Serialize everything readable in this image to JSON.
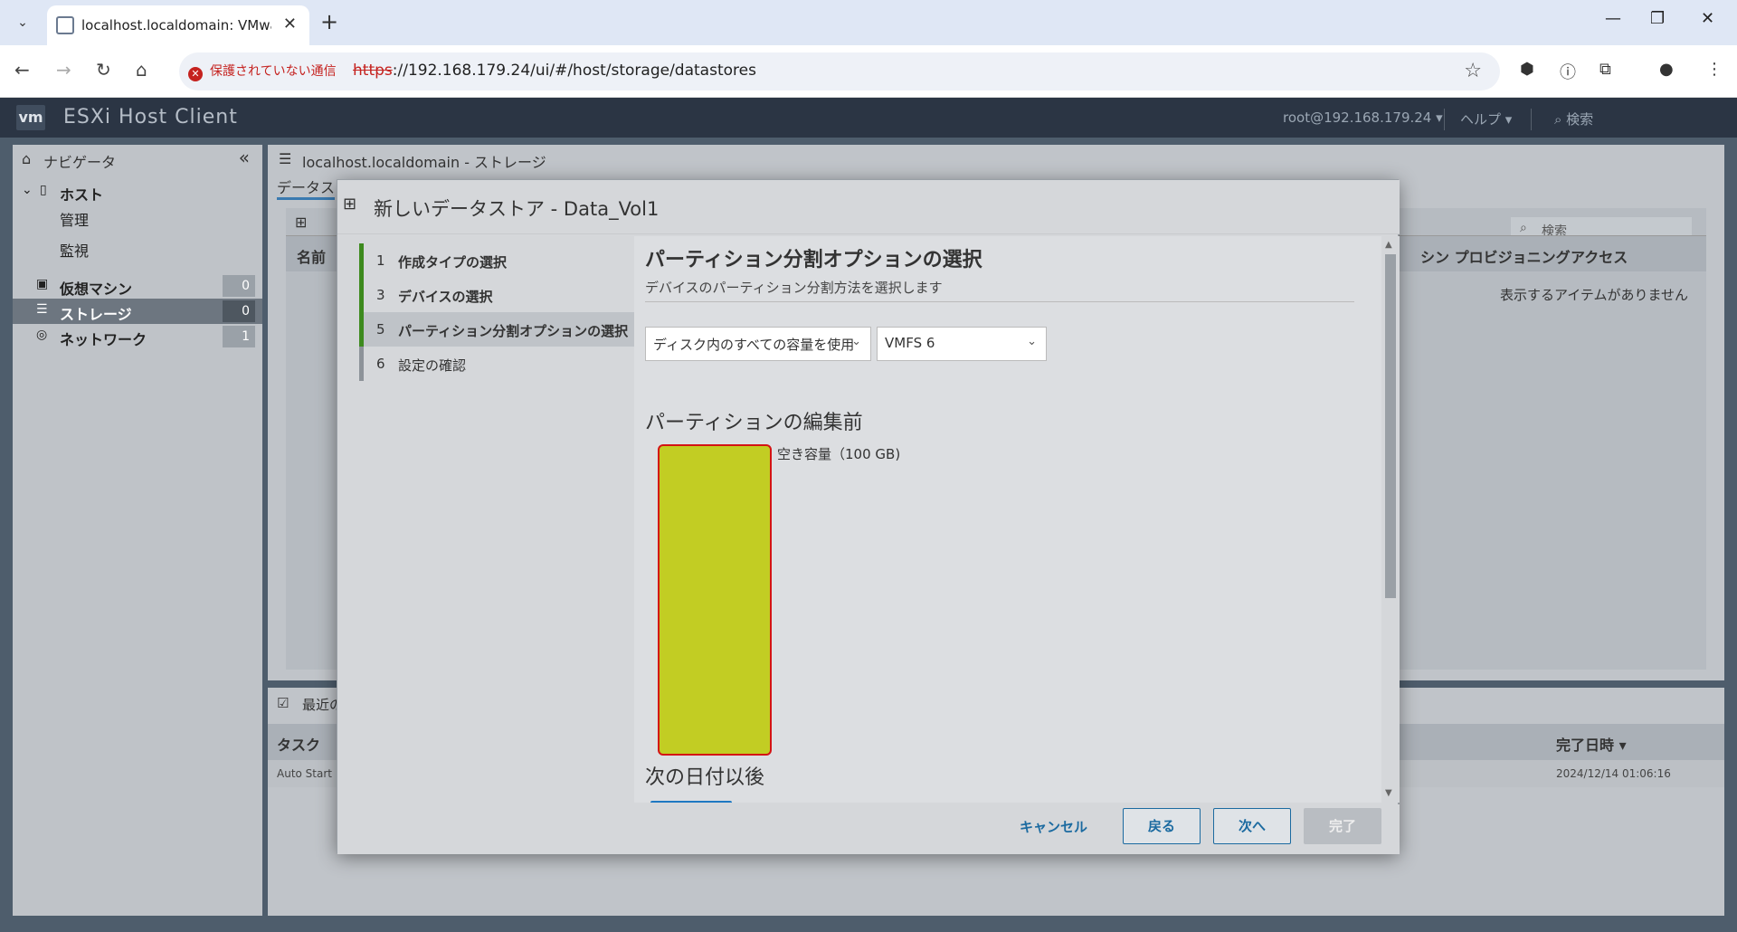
{
  "browser": {
    "tab_title": "localhost.localdomain: VMware",
    "new_tab": "+",
    "security_label": "保護されていない通信",
    "url_scheme": "https",
    "url_rest": "://192.168.179.24/ui/#/host/storage/datastores"
  },
  "app": {
    "logo": "vm",
    "title": "ESXi Host Client",
    "user": "root@192.168.179.24 ▾",
    "help": "ヘルプ ▾",
    "search": "検索"
  },
  "navigator": {
    "title": "ナビゲータ",
    "host": "ホスト",
    "manage": "管理",
    "monitor": "監視",
    "items": [
      {
        "label": "仮想マシン",
        "count": "0"
      },
      {
        "label": "ストレージ",
        "count": "0"
      },
      {
        "label": "ネットワーク",
        "count": "1"
      }
    ]
  },
  "main": {
    "title": "localhost.localdomain - ストレージ",
    "tab": "データス",
    "col_name": "名前",
    "col_thin": "シン プロビジョニング",
    "col_access": "アクセス",
    "search_placeholder": "検索",
    "no_items": "表示するアイテムがありません"
  },
  "tasks": {
    "title": "最近の",
    "col_task": "タスク",
    "col_done": "完了日時 ▾",
    "row_task": "Auto Start",
    "row_time": "2024/12/14 01:06:16"
  },
  "modal": {
    "title": "新しいデータストア - Data_Vol1",
    "steps": [
      {
        "num": "1",
        "label": "作成タイプの選択"
      },
      {
        "num": "3",
        "label": "デバイスの選択"
      },
      {
        "num": "5",
        "label": "パーティション分割オプションの選択"
      },
      {
        "num": "6",
        "label": "設定の確認"
      }
    ],
    "heading": "パーティション分割オプションの選択",
    "subheading": "デバイスのパーティション分割方法を選択します",
    "select_usage": "ディスク内のすべての容量を使用",
    "select_fs": "VMFS 6",
    "before_title": "パーティションの編集前",
    "free_label": "空き容量（100 GB)",
    "after_title": "次の日付以後",
    "partition_color": "#c2cd23",
    "buttons": {
      "cancel": "キャンセル",
      "back": "戻る",
      "next": "次へ",
      "finish": "完了"
    }
  }
}
